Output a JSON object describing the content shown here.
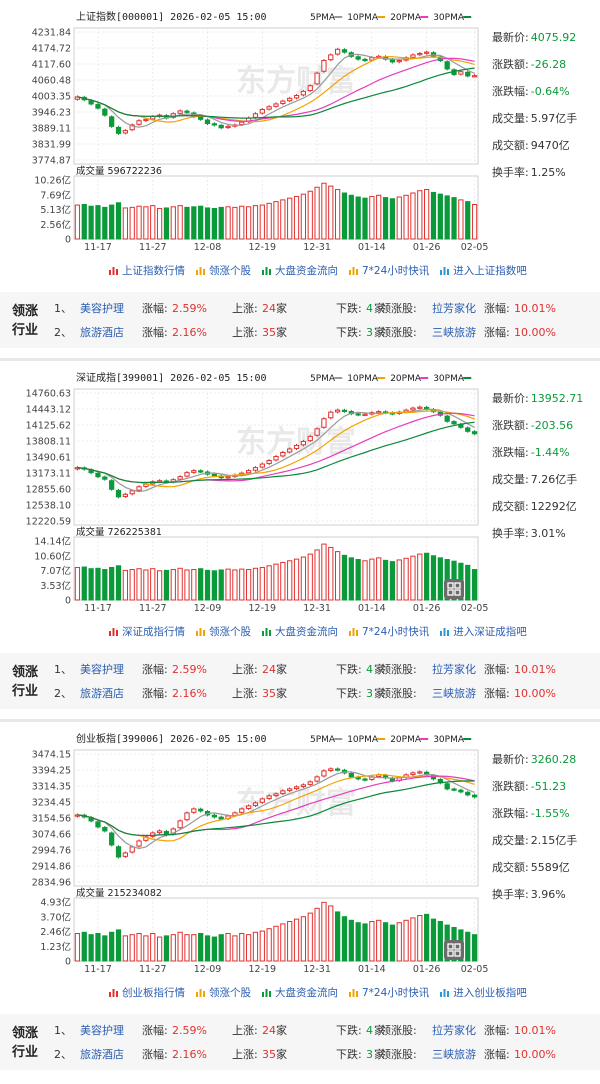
{
  "chart_data": [
    {
      "type": "candlestick",
      "title": "上证指数[000001] 2026-02-05 15:00",
      "ma_legend": [
        "5PMA",
        "10PMA",
        "20PMA",
        "30PMA"
      ],
      "ma_colors": [
        "#999999",
        "#f2a300",
        "#e63cbe",
        "#0a8a3a"
      ],
      "y_ticks": [
        "4231.84",
        "4174.72",
        "4117.60",
        "4060.48",
        "4003.35",
        "3946.23",
        "3889.11",
        "3831.99",
        "3774.87"
      ],
      "ylim": [
        3774.87,
        4231.84
      ],
      "x_ticks": [
        "11-17",
        "11-27",
        "12-08",
        "12-19",
        "12-31",
        "01-14",
        "01-26",
        "02-05"
      ],
      "x_tick_index": [
        3,
        11,
        19,
        27,
        35,
        43,
        51,
        58
      ],
      "volume_label": "成交量 596722236",
      "volume_ticks": [
        "10.26亿",
        "7.69亿",
        "5.13亿",
        "2.56亿",
        "0"
      ],
      "volume_max": 10.26,
      "closes": [
        4000,
        3990,
        3975,
        3960,
        3935,
        3895,
        3870,
        3880,
        3900,
        3915,
        3920,
        3930,
        3935,
        3925,
        3940,
        3950,
        3945,
        3930,
        3920,
        3905,
        3900,
        3890,
        3895,
        3900,
        3910,
        3925,
        3940,
        3955,
        3965,
        3975,
        3985,
        3995,
        4005,
        4020,
        4040,
        4085,
        4130,
        4150,
        4170,
        4160,
        4145,
        4135,
        4130,
        4140,
        4145,
        4135,
        4125,
        4130,
        4140,
        4150,
        4155,
        4160,
        4145,
        4130,
        4100,
        4080,
        4090,
        4075,
        4076
      ],
      "volumes": [
        5.9,
        6.0,
        5.7,
        5.8,
        5.5,
        5.9,
        6.3,
        5.4,
        5.5,
        5.7,
        5.6,
        5.8,
        5.3,
        5.4,
        5.6,
        5.8,
        5.5,
        5.6,
        5.7,
        5.4,
        5.3,
        5.5,
        5.6,
        5.5,
        5.7,
        5.6,
        5.8,
        5.9,
        6.2,
        6.5,
        6.8,
        7.1,
        7.4,
        7.8,
        8.3,
        9.0,
        9.7,
        9.2,
        8.6,
        8.0,
        7.6,
        7.3,
        7.1,
        7.4,
        7.6,
        7.2,
        7.0,
        7.3,
        7.6,
        8.0,
        8.4,
        8.6,
        8.1,
        7.8,
        7.5,
        7.2,
        6.8,
        6.5,
        6.0
      ],
      "quote": [
        {
          "label": "最新价:",
          "value": "4075.92",
          "color": "green"
        },
        {
          "label": "涨跌额:",
          "value": "-26.28",
          "color": "green"
        },
        {
          "label": "涨跌幅:",
          "value": "-0.64%",
          "color": "green"
        },
        {
          "label": "成交量:",
          "value": "5.97亿手",
          "color": "plain"
        },
        {
          "label": "成交额:",
          "value": "9470亿",
          "color": "plain"
        },
        {
          "label": "换手率:",
          "value": "1.25%",
          "color": "plain"
        }
      ],
      "links": [
        "上证指数行情",
        "领涨个股",
        "大盘资金流向",
        "7*24小时快讯",
        "进入上证指数吧"
      ]
    },
    {
      "type": "candlestick",
      "title": "深证成指[399001] 2026-02-05 15:00",
      "ma_legend": [
        "5PMA",
        "10PMA",
        "20PMA",
        "30PMA"
      ],
      "ma_colors": [
        "#999999",
        "#f2a300",
        "#e63cbe",
        "#0a8a3a"
      ],
      "y_ticks": [
        "14760.63",
        "14443.12",
        "14125.62",
        "13808.11",
        "13490.61",
        "13173.11",
        "12855.60",
        "12538.10",
        "12220.59"
      ],
      "ylim": [
        12220.59,
        14760.63
      ],
      "x_ticks": [
        "11-17",
        "11-27",
        "12-09",
        "12-19",
        "12-31",
        "01-14",
        "01-26",
        "02-05"
      ],
      "x_tick_index": [
        3,
        11,
        19,
        27,
        35,
        43,
        51,
        58
      ],
      "volume_label": "成交量 726225381",
      "volume_ticks": [
        "14.14亿",
        "10.60亿",
        "7.07亿",
        "3.53亿",
        "0"
      ],
      "volume_max": 14.14,
      "closes": [
        13280,
        13250,
        13180,
        13100,
        13050,
        12850,
        12700,
        12750,
        12820,
        12900,
        12950,
        13000,
        13020,
        12990,
        13040,
        13100,
        13180,
        13220,
        13200,
        13150,
        13120,
        13080,
        13100,
        13130,
        13170,
        13220,
        13280,
        13350,
        13420,
        13500,
        13580,
        13650,
        13720,
        13800,
        13900,
        14050,
        14250,
        14380,
        14420,
        14400,
        14350,
        14330,
        14340,
        14370,
        14390,
        14370,
        14350,
        14380,
        14420,
        14460,
        14480,
        14440,
        14390,
        14320,
        14200,
        14150,
        14080,
        14000,
        13952
      ],
      "volumes": [
        7.8,
        7.9,
        7.5,
        7.6,
        7.3,
        7.8,
        8.2,
        7.1,
        7.3,
        7.5,
        7.2,
        7.5,
        7.0,
        7.1,
        7.3,
        7.6,
        7.2,
        7.3,
        7.5,
        7.1,
        7.0,
        7.2,
        7.4,
        7.2,
        7.4,
        7.3,
        7.6,
        7.8,
        8.2,
        8.6,
        9.0,
        9.4,
        9.8,
        10.3,
        11.0,
        12.0,
        13.4,
        12.6,
        11.6,
        10.7,
        10.1,
        9.7,
        9.4,
        9.8,
        10.1,
        9.5,
        9.2,
        9.6,
        10.0,
        10.5,
        11.0,
        11.2,
        10.6,
        10.1,
        9.7,
        9.3,
        8.8,
        8.3,
        7.3
      ],
      "quote": [
        {
          "label": "最新价:",
          "value": "13952.71",
          "color": "green"
        },
        {
          "label": "涨跌额:",
          "value": "-203.56",
          "color": "green"
        },
        {
          "label": "涨跌幅:",
          "value": "-1.44%",
          "color": "green"
        },
        {
          "label": "成交量:",
          "value": "7.26亿手",
          "color": "plain"
        },
        {
          "label": "成交额:",
          "value": "12292亿",
          "color": "plain"
        },
        {
          "label": "换手率:",
          "value": "3.01%",
          "color": "plain"
        }
      ],
      "links": [
        "深证成指行情",
        "领涨个股",
        "大盘资金流向",
        "7*24小时快讯",
        "进入深证成指吧"
      ]
    },
    {
      "type": "candlestick",
      "title": "创业板指[399006] 2026-02-05 15:00",
      "ma_legend": [
        "5PMA",
        "10PMA",
        "20PMA",
        "30PMA"
      ],
      "ma_colors": [
        "#999999",
        "#f2a300",
        "#e63cbe",
        "#0a8a3a"
      ],
      "y_ticks": [
        "3474.15",
        "3394.25",
        "3314.35",
        "3234.45",
        "3154.56",
        "3074.66",
        "2994.76",
        "2914.86",
        "2834.96"
      ],
      "ylim": [
        2834.96,
        3474.15
      ],
      "x_ticks": [
        "11-17",
        "11-27",
        "12-09",
        "12-19",
        "12-31",
        "01-14",
        "01-26",
        "02-05"
      ],
      "x_tick_index": [
        3,
        11,
        19,
        27,
        35,
        43,
        51,
        58
      ],
      "volume_label": "成交量 215234082",
      "volume_ticks": [
        "4.93亿",
        "3.70亿",
        "2.46亿",
        "1.23亿",
        "0"
      ],
      "volume_max": 4.93,
      "closes": [
        3170,
        3160,
        3140,
        3110,
        3090,
        3020,
        2960,
        2980,
        3010,
        3040,
        3060,
        3080,
        3090,
        3070,
        3100,
        3140,
        3180,
        3200,
        3190,
        3170,
        3160,
        3150,
        3165,
        3180,
        3200,
        3215,
        3230,
        3250,
        3265,
        3275,
        3290,
        3300,
        3310,
        3320,
        3335,
        3360,
        3390,
        3400,
        3395,
        3380,
        3360,
        3350,
        3345,
        3360,
        3370,
        3355,
        3340,
        3355,
        3370,
        3380,
        3385,
        3370,
        3350,
        3330,
        3300,
        3295,
        3285,
        3270,
        3260
      ],
      "volumes": [
        2.3,
        2.4,
        2.2,
        2.3,
        2.1,
        2.4,
        2.6,
        2.1,
        2.2,
        2.3,
        2.1,
        2.3,
        2.0,
        2.1,
        2.2,
        2.4,
        2.2,
        2.2,
        2.3,
        2.1,
        2.0,
        2.2,
        2.3,
        2.1,
        2.3,
        2.2,
        2.4,
        2.5,
        2.7,
        2.9,
        3.1,
        3.3,
        3.5,
        3.7,
        4.0,
        4.4,
        4.9,
        4.6,
        4.1,
        3.7,
        3.4,
        3.2,
        3.1,
        3.3,
        3.4,
        3.2,
        3.0,
        3.2,
        3.4,
        3.6,
        3.8,
        3.9,
        3.5,
        3.3,
        3.0,
        2.8,
        2.6,
        2.4,
        2.2
      ],
      "quote": [
        {
          "label": "最新价:",
          "value": "3260.28",
          "color": "green"
        },
        {
          "label": "涨跌额:",
          "value": "-51.23",
          "color": "green"
        },
        {
          "label": "涨跌幅:",
          "value": "-1.55%",
          "color": "green"
        },
        {
          "label": "成交量:",
          "value": "2.15亿手",
          "color": "plain"
        },
        {
          "label": "成交额:",
          "value": "5589亿",
          "color": "plain"
        },
        {
          "label": "换手率:",
          "value": "3.96%",
          "color": "plain"
        }
      ],
      "links": [
        "创业板指行情",
        "领涨个股",
        "大盘资金流向",
        "7*24小时快讯",
        "进入创业板指吧"
      ]
    }
  ],
  "watermark": "东方财富",
  "industry": {
    "title_line1": "领涨",
    "title_line2": "行业",
    "rows": [
      {
        "no": "1、",
        "name": "美容护理",
        "chg_label": "涨幅:",
        "chg": "2.59%",
        "up_label": "上涨:",
        "up": "24",
        "unit": "家",
        "down_label": "下跌:",
        "down": "4",
        "lead_label": "领涨股:",
        "lead": "拉芳家化",
        "lead_chg_label": "涨幅:",
        "lead_chg": "10.01%"
      },
      {
        "no": "2、",
        "name": "旅游酒店",
        "chg_label": "涨幅:",
        "chg": "2.16%",
        "up_label": "上涨:",
        "up": "35",
        "unit": "家",
        "down_label": "下跌:",
        "down": "3",
        "lead_label": "领涨股:",
        "lead": "三峡旅游",
        "lead_chg_label": "涨幅:",
        "lead_chg": "10.00%"
      }
    ]
  },
  "colors": {
    "up": "#e0312f",
    "down": "#0a9a3a",
    "link": "#2a5db0"
  }
}
